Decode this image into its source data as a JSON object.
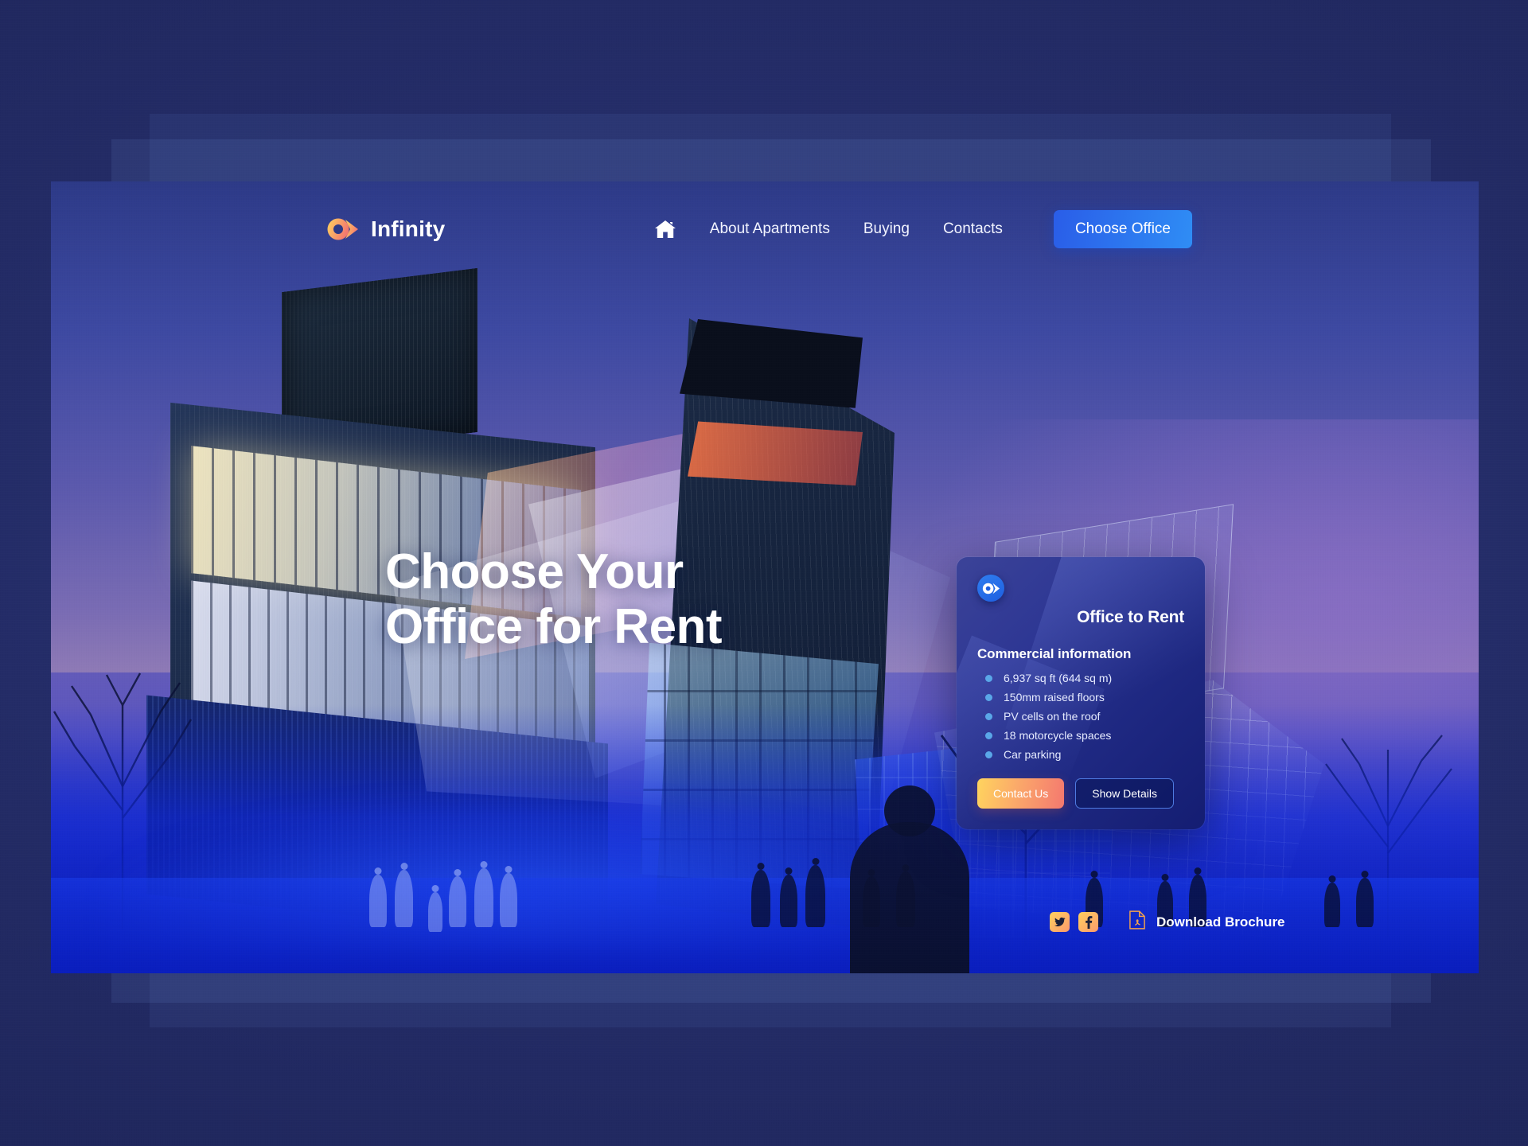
{
  "brand": {
    "name": "Infinity",
    "logo_icon": "alpha-logo-icon",
    "logo_gradient_from": "#ffd45e",
    "logo_gradient_to": "#f4786f"
  },
  "nav": {
    "home_icon": "home-icon",
    "links": [
      {
        "label": "About Apartments"
      },
      {
        "label": "Buying"
      },
      {
        "label": "Contacts"
      }
    ],
    "cta_label": "Choose Office",
    "cta_color": "#2f8df5"
  },
  "hero": {
    "headline_line1": "Choose Your",
    "headline_line2": "Office for Rent"
  },
  "card": {
    "badge_icon": "alpha-badge-icon",
    "title": "Office to Rent",
    "subtitle": "Commercial information",
    "features": [
      "6,937 sq ft (644 sq m)",
      "150mm raised floors",
      "PV cells on the roof",
      "18 motorcycle spaces",
      "Car parking"
    ],
    "primary_button": "Contact Us",
    "secondary_button": "Show Details",
    "primary_color": "#fba96a",
    "secondary_border": "#4e7ae0",
    "bullet_color": "#5aa7e8"
  },
  "footer": {
    "social": [
      {
        "name": "twitter-icon"
      },
      {
        "name": "facebook-icon"
      }
    ],
    "pdf_icon": "pdf-file-icon",
    "brochure_label": "Download Brochure"
  }
}
